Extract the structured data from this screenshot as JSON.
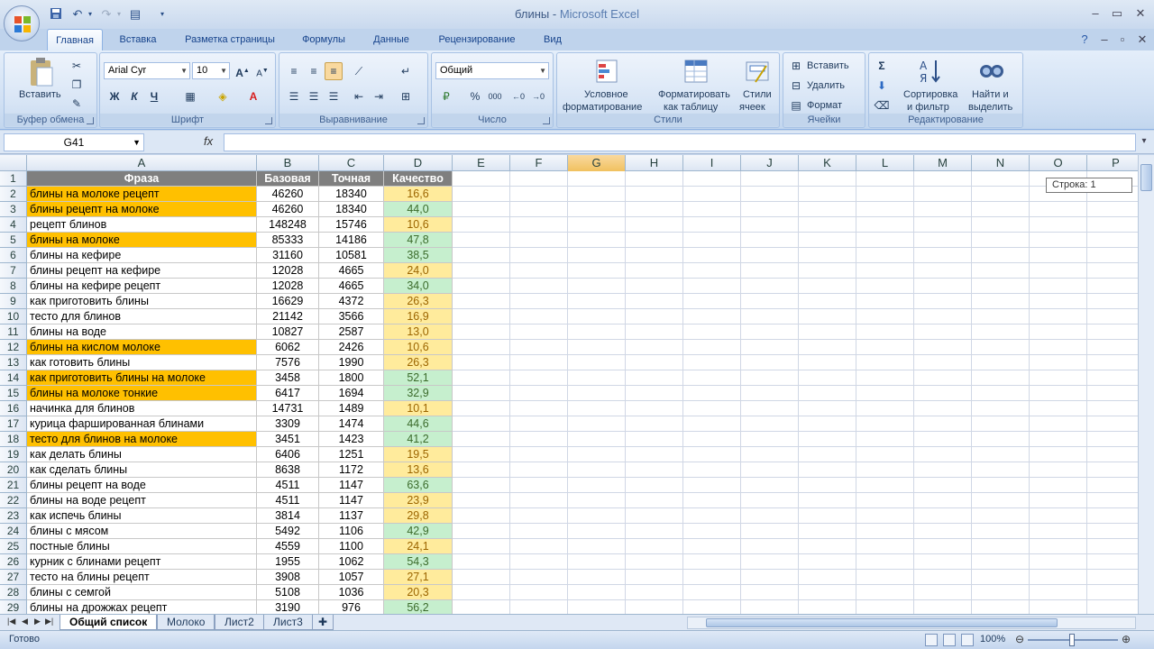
{
  "window": {
    "title_doc": "блины",
    "title_sep": " - ",
    "title_app": "Microsoft Excel"
  },
  "ribbon_tabs": [
    "Главная",
    "Вставка",
    "Разметка страницы",
    "Формулы",
    "Данные",
    "Рецензирование",
    "Вид"
  ],
  "ribbon": {
    "clipboard": {
      "label": "Буфер обмена",
      "paste": "Вставить"
    },
    "font": {
      "label": "Шрифт",
      "font_name": "Arial Cyr",
      "font_size": "10",
      "bold": "Ж",
      "italic": "К",
      "underline": "Ч"
    },
    "alignment": {
      "label": "Выравнивание"
    },
    "number": {
      "label": "Число",
      "format": "Общий",
      "percent": "%",
      "thousands": "000"
    },
    "styles": {
      "label": "Стили",
      "conditional_1": "Условное",
      "conditional_2": "форматирование",
      "table_1": "Форматировать",
      "table_2": "как таблицу",
      "cell_1": "Стили",
      "cell_2": "ячеек"
    },
    "cells": {
      "label": "Ячейки",
      "insert": "Вставить",
      "delete": "Удалить",
      "format": "Формат"
    },
    "editing": {
      "label": "Редактирование",
      "sort_1": "Сортировка",
      "sort_2": "и фильтр",
      "find_1": "Найти и",
      "find_2": "выделить",
      "sum": "Σ"
    }
  },
  "formula_bar": {
    "name_box": "G41",
    "fx": "fx",
    "value": ""
  },
  "columns": [
    "A",
    "B",
    "C",
    "D",
    "E",
    "F",
    "G",
    "H",
    "I",
    "J",
    "K",
    "L",
    "M",
    "N",
    "O",
    "P"
  ],
  "selected_column": "G",
  "row_numbers": [
    "1",
    "2",
    "3",
    "4",
    "5",
    "6",
    "7",
    "8",
    "9",
    "10",
    "11",
    "12",
    "13",
    "14",
    "15",
    "16",
    "17",
    "18",
    "19",
    "20",
    "21",
    "22",
    "23",
    "24",
    "25",
    "26",
    "27",
    "28",
    "29"
  ],
  "headers": [
    "Фраза",
    "Базовая",
    "Точная",
    "Качество"
  ],
  "rows": [
    {
      "phrase": "блины на молоке рецепт",
      "base": "46260",
      "exact": "18340",
      "quality": "16,6",
      "hl": true,
      "q": "y"
    },
    {
      "phrase": "блины рецепт на молоке",
      "base": "46260",
      "exact": "18340",
      "quality": "44,0",
      "hl": true,
      "q": "g"
    },
    {
      "phrase": "рецепт блинов",
      "base": "148248",
      "exact": "15746",
      "quality": "10,6",
      "hl": false,
      "q": "y"
    },
    {
      "phrase": "блины на молоке",
      "base": "85333",
      "exact": "14186",
      "quality": "47,8",
      "hl": true,
      "q": "g"
    },
    {
      "phrase": "блины на кефире",
      "base": "31160",
      "exact": "10581",
      "quality": "38,5",
      "hl": false,
      "q": "g"
    },
    {
      "phrase": "блины рецепт на кефире",
      "base": "12028",
      "exact": "4665",
      "quality": "24,0",
      "hl": false,
      "q": "y"
    },
    {
      "phrase": "блины на кефире рецепт",
      "base": "12028",
      "exact": "4665",
      "quality": "34,0",
      "hl": false,
      "q": "g"
    },
    {
      "phrase": "как приготовить блины",
      "base": "16629",
      "exact": "4372",
      "quality": "26,3",
      "hl": false,
      "q": "y"
    },
    {
      "phrase": "тесто для блинов",
      "base": "21142",
      "exact": "3566",
      "quality": "16,9",
      "hl": false,
      "q": "y"
    },
    {
      "phrase": "блины на воде",
      "base": "10827",
      "exact": "2587",
      "quality": "13,0",
      "hl": false,
      "q": "y"
    },
    {
      "phrase": "блины на кислом молоке",
      "base": "6062",
      "exact": "2426",
      "quality": "10,6",
      "hl": true,
      "q": "y"
    },
    {
      "phrase": "как готовить блины",
      "base": "7576",
      "exact": "1990",
      "quality": "26,3",
      "hl": false,
      "q": "y"
    },
    {
      "phrase": "как приготовить блины на молоке",
      "base": "3458",
      "exact": "1800",
      "quality": "52,1",
      "hl": true,
      "q": "g"
    },
    {
      "phrase": "блины на молоке тонкие",
      "base": "6417",
      "exact": "1694",
      "quality": "32,9",
      "hl": true,
      "q": "g"
    },
    {
      "phrase": "начинка для блинов",
      "base": "14731",
      "exact": "1489",
      "quality": "10,1",
      "hl": false,
      "q": "y"
    },
    {
      "phrase": "курица фаршированная блинами",
      "base": "3309",
      "exact": "1474",
      "quality": "44,6",
      "hl": false,
      "q": "g"
    },
    {
      "phrase": "тесто для блинов на молоке",
      "base": "3451",
      "exact": "1423",
      "quality": "41,2",
      "hl": true,
      "q": "g"
    },
    {
      "phrase": "как делать блины",
      "base": "6406",
      "exact": "1251",
      "quality": "19,5",
      "hl": false,
      "q": "y"
    },
    {
      "phrase": "как сделать блины",
      "base": "8638",
      "exact": "1172",
      "quality": "13,6",
      "hl": false,
      "q": "y"
    },
    {
      "phrase": "блины рецепт на воде",
      "base": "4511",
      "exact": "1147",
      "quality": "63,6",
      "hl": false,
      "q": "g"
    },
    {
      "phrase": "блины на воде рецепт",
      "base": "4511",
      "exact": "1147",
      "quality": "23,9",
      "hl": false,
      "q": "y"
    },
    {
      "phrase": "как испечь блины",
      "base": "3814",
      "exact": "1137",
      "quality": "29,8",
      "hl": false,
      "q": "y"
    },
    {
      "phrase": "блины с мясом",
      "base": "5492",
      "exact": "1106",
      "quality": "42,9",
      "hl": false,
      "q": "g"
    },
    {
      "phrase": "постные блины",
      "base": "4559",
      "exact": "1100",
      "quality": "24,1",
      "hl": false,
      "q": "y"
    },
    {
      "phrase": "курник с блинами рецепт",
      "base": "1955",
      "exact": "1062",
      "quality": "54,3",
      "hl": false,
      "q": "g"
    },
    {
      "phrase": "тесто на блины рецепт",
      "base": "3908",
      "exact": "1057",
      "quality": "27,1",
      "hl": false,
      "q": "y"
    },
    {
      "phrase": "блины с семгой",
      "base": "5108",
      "exact": "1036",
      "quality": "20,3",
      "hl": false,
      "q": "y"
    },
    {
      "phrase": "блины на дрожжах рецепт",
      "base": "3190",
      "exact": "976",
      "quality": "56,2",
      "hl": false,
      "q": "g"
    }
  ],
  "tooltip": "Строка: 1",
  "sheets": [
    "Общий список",
    "Молоко",
    "Лист2",
    "Лист3"
  ],
  "active_sheet": "Общий список",
  "status": {
    "ready": "Готово",
    "zoom": "100%"
  },
  "colors": {
    "highlight": "#ffc000",
    "good": "#c6efce",
    "neutral": "#ffeb9c",
    "header": "#7f7f7f"
  }
}
